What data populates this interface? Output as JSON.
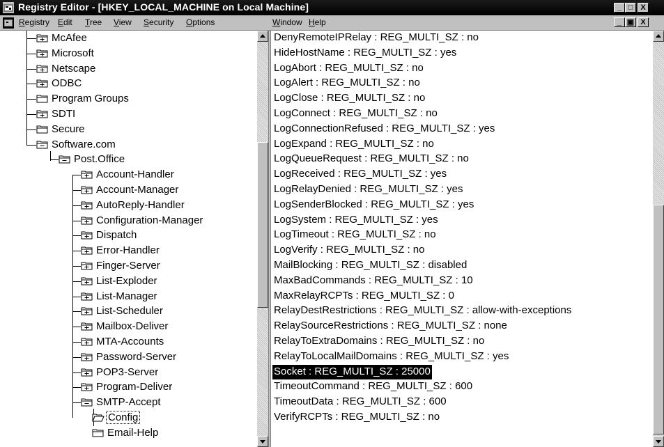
{
  "window": {
    "title": "Registry Editor - [HKEY_LOCAL_MACHINE on Local Machine]",
    "minimize_glyph": "_",
    "maximize_glyph": "□",
    "close_glyph": "X",
    "mdi_minimize_glyph": "_",
    "mdi_restore_glyph": "▣",
    "mdi_close_glyph": "X"
  },
  "menu": [
    {
      "label": "Registry",
      "underline": "R",
      "rest": "egistry"
    },
    {
      "label": "Edit",
      "underline": "E",
      "rest": "dit"
    },
    {
      "label": "Tree",
      "underline": "T",
      "rest": "ree"
    },
    {
      "label": "View",
      "underline": "V",
      "rest": "iew"
    },
    {
      "label": "Security",
      "underline": "S",
      "rest": "ecurity"
    },
    {
      "label": "Options",
      "underline": "O",
      "rest": "ptions"
    },
    {
      "label": "Window",
      "underline": "W",
      "rest": "indow"
    },
    {
      "label": "Help",
      "underline": "H",
      "rest": "elp"
    }
  ],
  "tree": {
    "nodes": [
      {
        "label": "McAfee",
        "level": 0,
        "state": "collapsed"
      },
      {
        "label": "Microsoft",
        "level": 0,
        "state": "collapsed"
      },
      {
        "label": "Netscape",
        "level": 0,
        "state": "collapsed"
      },
      {
        "label": "ODBC",
        "level": 0,
        "state": "collapsed"
      },
      {
        "label": "Program Groups",
        "level": 0,
        "state": "leaf"
      },
      {
        "label": "SDTI",
        "level": 0,
        "state": "collapsed"
      },
      {
        "label": "Secure",
        "level": 0,
        "state": "leaf"
      },
      {
        "label": "Software.com",
        "level": 0,
        "state": "expanded"
      },
      {
        "label": "Post.Office",
        "level": 1,
        "state": "expanded"
      },
      {
        "label": "Account-Handler",
        "level": 2,
        "state": "collapsed"
      },
      {
        "label": "Account-Manager",
        "level": 2,
        "state": "collapsed"
      },
      {
        "label": "AutoReply-Handler",
        "level": 2,
        "state": "collapsed"
      },
      {
        "label": "Configuration-Manager",
        "level": 2,
        "state": "collapsed"
      },
      {
        "label": "Dispatch",
        "level": 2,
        "state": "collapsed"
      },
      {
        "label": "Error-Handler",
        "level": 2,
        "state": "collapsed"
      },
      {
        "label": "Finger-Server",
        "level": 2,
        "state": "collapsed"
      },
      {
        "label": "List-Exploder",
        "level": 2,
        "state": "collapsed"
      },
      {
        "label": "List-Manager",
        "level": 2,
        "state": "collapsed"
      },
      {
        "label": "List-Scheduler",
        "level": 2,
        "state": "collapsed"
      },
      {
        "label": "Mailbox-Deliver",
        "level": 2,
        "state": "collapsed"
      },
      {
        "label": "MTA-Accounts",
        "level": 2,
        "state": "collapsed"
      },
      {
        "label": "Password-Server",
        "level": 2,
        "state": "collapsed"
      },
      {
        "label": "POP3-Server",
        "level": 2,
        "state": "collapsed"
      },
      {
        "label": "Program-Deliver",
        "level": 2,
        "state": "collapsed"
      },
      {
        "label": "SMTP-Accept",
        "level": 2,
        "state": "expanded"
      },
      {
        "label": "Config",
        "level": 3,
        "state": "open",
        "selected": true
      },
      {
        "label": "Email-Help",
        "level": 3,
        "state": "leaf"
      }
    ]
  },
  "values": [
    "DenyRemoteIPRelay : REG_MULTI_SZ : no",
    "HideHostName : REG_MULTI_SZ : yes",
    "LogAbort : REG_MULTI_SZ : no",
    "LogAlert : REG_MULTI_SZ : no",
    "LogClose : REG_MULTI_SZ : no",
    "LogConnect : REG_MULTI_SZ : no",
    "LogConnectionRefused : REG_MULTI_SZ : yes",
    "LogExpand : REG_MULTI_SZ : no",
    "LogQueueRequest : REG_MULTI_SZ : no",
    "LogReceived : REG_MULTI_SZ : yes",
    "LogRelayDenied : REG_MULTI_SZ : yes",
    "LogSenderBlocked : REG_MULTI_SZ : yes",
    "LogSystem : REG_MULTI_SZ : yes",
    "LogTimeout : REG_MULTI_SZ : no",
    "LogVerify : REG_MULTI_SZ : no",
    "MailBlocking : REG_MULTI_SZ : disabled",
    "MaxBadCommands : REG_MULTI_SZ : 10",
    "MaxRelayRCPTs : REG_MULTI_SZ : 0",
    "RelayDestRestrictions : REG_MULTI_SZ : allow-with-exceptions",
    "RelaySourceRestrictions : REG_MULTI_SZ : none",
    "RelayToExtraDomains : REG_MULTI_SZ : no",
    "RelayToLocalMailDomains : REG_MULTI_SZ : yes",
    "Socket : REG_MULTI_SZ : 25000",
    "TimeoutCommand : REG_MULTI_SZ : 600",
    "TimeoutData : REG_MULTI_SZ : 600",
    "VerifyRCPTs : REG_MULTI_SZ : no"
  ],
  "selected_value_index": 22,
  "colors": {
    "titlebar": "#000000",
    "face": "#c0c0c0",
    "selection": "#000000"
  }
}
